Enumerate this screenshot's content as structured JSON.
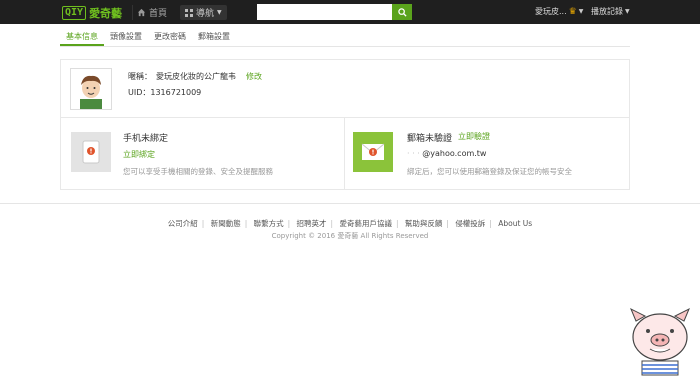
{
  "header": {
    "logo_box": "QIY",
    "logo_text": "愛奇藝",
    "home_label": "首頁",
    "guide_label": "導航",
    "search": {
      "value": "",
      "placeholder": ""
    },
    "user_name": "愛玩皮...",
    "history_label": "播放記錄"
  },
  "tabs": [
    {
      "label": "基本信息",
      "active": true
    },
    {
      "label": "頭像設置",
      "active": false
    },
    {
      "label": "更改密碼",
      "active": false
    },
    {
      "label": "郵箱設置",
      "active": false
    }
  ],
  "profile": {
    "nickname_label": "暱稱：",
    "nickname_value": "愛玩皮化妝的公广龍韦",
    "edit_label": "修改",
    "uid_label": "UID：",
    "uid_value": "1316721009"
  },
  "phone": {
    "title": "手机未綁定",
    "link": "立即綁定",
    "desc": "您可以享受手機相關的登錄、安全及提醒服務"
  },
  "email": {
    "title": "郵箱未驗證",
    "link": "立即驗證",
    "address": "@yahoo.com.tw",
    "desc": "綁定后，您可以使用郵箱登錄及保证您的帳号安全"
  },
  "footer": {
    "links": [
      "公司介紹",
      "新聞動態",
      "聯繫方式",
      "招聘英才",
      "愛奇藝用戶協議",
      "幫助與反饋",
      "侵權投訴",
      "About Us"
    ],
    "copyright": "Copyright © 2016 愛奇藝 All Rights Reserved"
  },
  "colors": {
    "accent": "#5aa31c",
    "topbar": "#1f1f1f"
  }
}
